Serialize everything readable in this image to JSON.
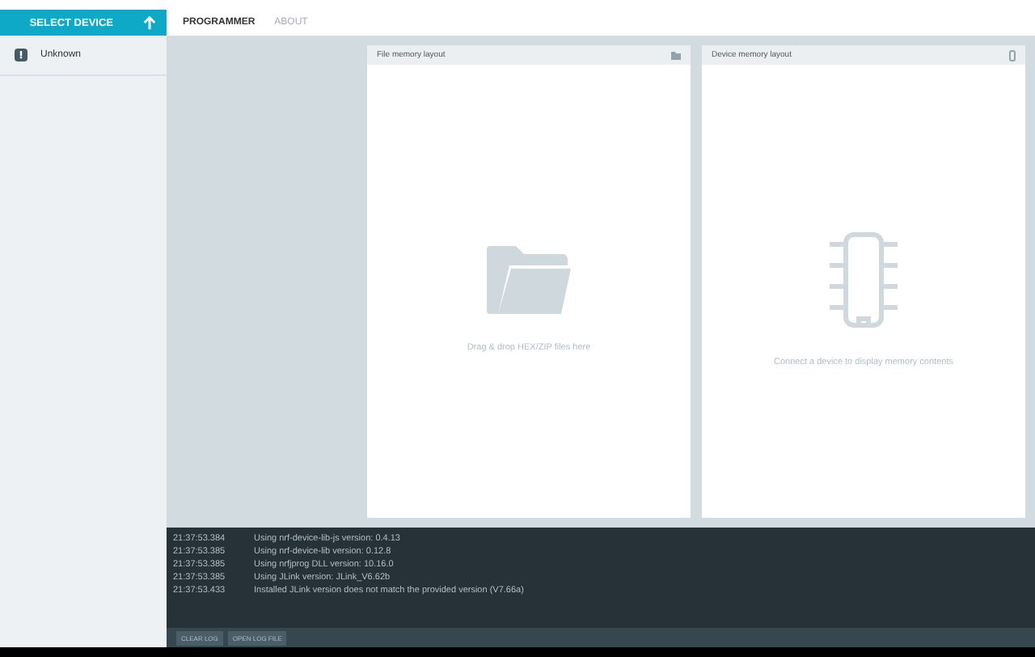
{
  "sidebar": {
    "header": "SELECT DEVICE",
    "device": "Unknown"
  },
  "tabs": [
    {
      "label": "PROGRAMMER",
      "selected": true
    },
    {
      "label": "ABOUT",
      "selected": false
    }
  ],
  "file_panel": {
    "title": "File memory layout",
    "hint": "Drag & drop HEX/ZIP files here"
  },
  "device_panel": {
    "title": "Device memory layout",
    "hint": "Connect a device to display memory contents"
  },
  "log": [
    {
      "time": "21:37:53.384",
      "message": "Using nrf-device-lib-js version: 0.4.13"
    },
    {
      "time": "21:37:53.385",
      "message": "Using nrf-device-lib version: 0.12.8"
    },
    {
      "time": "21:37:53.385",
      "message": "Using nrfjprog DLL version: 10.16.0"
    },
    {
      "time": "21:37:53.385",
      "message": "Using JLink version: JLink_V6.62b"
    },
    {
      "time": "21:37:53.433",
      "message": "Installed JLink version does not match the provided version (V7.66a)"
    }
  ],
  "log_buttons": [
    "CLEAR LOG",
    "OPEN LOG FILE"
  ]
}
